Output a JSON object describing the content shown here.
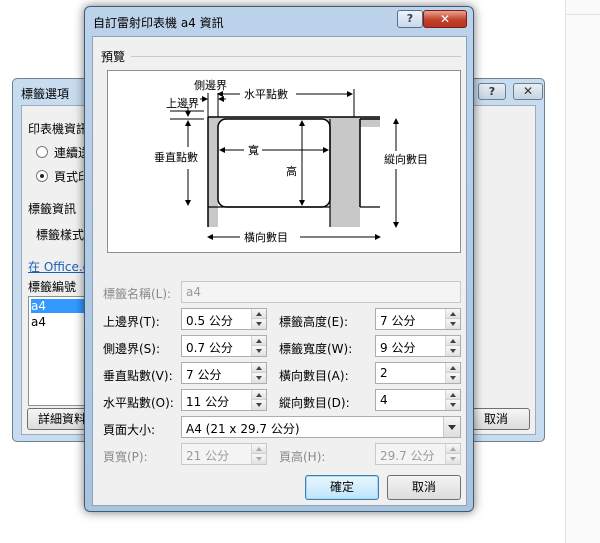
{
  "background_dialog": {
    "title": "標籤選項",
    "help_label": "?",
    "close_label": "✕",
    "printer_info_label": "印表機資訊",
    "option_continuous": "連續送",
    "option_page": "頁式印",
    "label_info_label": "標籤資訊",
    "label_vendor_label": "標籤樣式",
    "office_link": "在 Office.c",
    "label_number_label": "標籤編號",
    "list_items": [
      "a4",
      "a4"
    ],
    "details_button": "詳細資料",
    "cancel_button": "取消"
  },
  "dialog": {
    "title": "自訂雷射印表機 a4 資訊",
    "help_label": "?",
    "close_label": "✕",
    "preview_label": "預覽",
    "diagram": {
      "side_margin": "側邊界",
      "top_margin": "上邊界",
      "horizontal_pitch": "水平點數",
      "vertical_pitch": "垂直點數",
      "width": "寬",
      "height": "高",
      "number_down": "縱向數目",
      "number_across": "橫向數目"
    },
    "label_name": {
      "label": "標籤名稱(L):",
      "value": "a4"
    },
    "fields": {
      "top_margin": {
        "label": "上邊界(T):",
        "value": "0.5 公分"
      },
      "side_margin": {
        "label": "側邊界(S):",
        "value": "0.7 公分"
      },
      "vertical_pitch": {
        "label": "垂直點數(V):",
        "value": "7 公分"
      },
      "horizontal_pitch": {
        "label": "水平點數(O):",
        "value": "11 公分"
      },
      "label_height": {
        "label": "標籤高度(E):",
        "value": "7 公分"
      },
      "label_width": {
        "label": "標籤寬度(W):",
        "value": "9 公分"
      },
      "number_across": {
        "label": "橫向數目(A):",
        "value": "2"
      },
      "number_down": {
        "label": "縱向數目(D):",
        "value": "4"
      }
    },
    "page_size": {
      "label": "頁面大小:",
      "value": "A4 (21 x 29.7 公分)"
    },
    "page_width": {
      "label": "頁寬(P):",
      "value": "21 公分"
    },
    "page_height": {
      "label": "頁高(H):",
      "value": "29.7 公分"
    },
    "ok_button": "確定",
    "cancel_button": "取消"
  }
}
